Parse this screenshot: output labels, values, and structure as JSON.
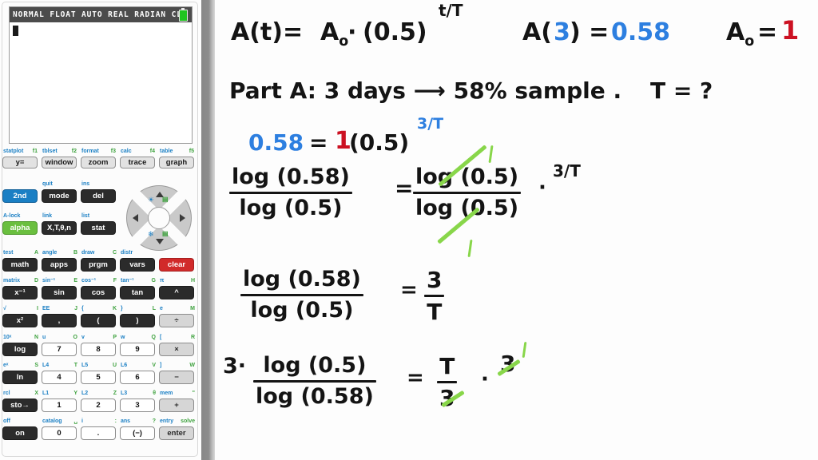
{
  "calculator": {
    "screen": {
      "status_text": "NORMAL FLOAT AUTO REAL RADIAN CL",
      "battery_icon": "battery-icon",
      "cursor": "█"
    },
    "fkey_row": [
      {
        "label": "y=",
        "second": "statplot",
        "alpha": "f1"
      },
      {
        "label": "window",
        "second": "tblset",
        "alpha": "f2"
      },
      {
        "label": "zoom",
        "second": "format",
        "alpha": "f3"
      },
      {
        "label": "trace",
        "second": "calc",
        "alpha": "f4"
      },
      {
        "label": "graph",
        "second": "table",
        "alpha": "f5"
      }
    ],
    "rows": [
      [
        {
          "label": "2nd",
          "style": "blue",
          "second": "",
          "alpha": ""
        },
        {
          "label": "mode",
          "style": "dark",
          "second": "quit",
          "alpha": ""
        },
        {
          "label": "del",
          "style": "dark",
          "second": "ins",
          "alpha": ""
        }
      ],
      [
        {
          "label": "alpha",
          "style": "green",
          "second": "A-lock",
          "alpha": ""
        },
        {
          "label": "X,T,θ,n",
          "style": "dark",
          "second": "link",
          "alpha": ""
        },
        {
          "label": "stat",
          "style": "dark",
          "second": "list",
          "alpha": ""
        }
      ],
      [
        {
          "label": "math",
          "style": "dark",
          "second": "test",
          "alpha": "A"
        },
        {
          "label": "apps",
          "style": "dark",
          "second": "angle",
          "alpha": "B"
        },
        {
          "label": "prgm",
          "style": "dark",
          "second": "draw",
          "alpha": "C"
        },
        {
          "label": "vars",
          "style": "dark",
          "second": "distr",
          "alpha": ""
        },
        {
          "label": "clear",
          "style": "red",
          "second": "",
          "alpha": ""
        }
      ],
      [
        {
          "label": "x⁻¹",
          "style": "dark",
          "second": "matrix",
          "alpha": "D"
        },
        {
          "label": "sin",
          "style": "dark",
          "second": "sin⁻¹",
          "alpha": "E"
        },
        {
          "label": "cos",
          "style": "dark",
          "second": "cos⁻¹",
          "alpha": "F"
        },
        {
          "label": "tan",
          "style": "dark",
          "second": "tan⁻¹",
          "alpha": "G"
        },
        {
          "label": "^",
          "style": "dark",
          "second": "π",
          "alpha": "H"
        }
      ],
      [
        {
          "label": "x²",
          "style": "dark",
          "second": "√",
          "alpha": "I"
        },
        {
          "label": ",",
          "style": "dark",
          "second": "EE",
          "alpha": "J"
        },
        {
          "label": "(",
          "style": "dark",
          "second": "{",
          "alpha": "K"
        },
        {
          "label": ")",
          "style": "dark",
          "second": "}",
          "alpha": "L"
        },
        {
          "label": "÷",
          "style": "gray",
          "second": "e",
          "alpha": "M"
        }
      ],
      [
        {
          "label": "log",
          "style": "dark",
          "second": "10ˣ",
          "alpha": "N"
        },
        {
          "label": "7",
          "style": "light",
          "second": "u",
          "alpha": "O"
        },
        {
          "label": "8",
          "style": "light",
          "second": "v",
          "alpha": "P"
        },
        {
          "label": "9",
          "style": "light",
          "second": "w",
          "alpha": "Q"
        },
        {
          "label": "×",
          "style": "gray",
          "second": "[",
          "alpha": "R"
        }
      ],
      [
        {
          "label": "ln",
          "style": "dark",
          "second": "eˣ",
          "alpha": "S"
        },
        {
          "label": "4",
          "style": "light",
          "second": "L4",
          "alpha": "T"
        },
        {
          "label": "5",
          "style": "light",
          "second": "L5",
          "alpha": "U"
        },
        {
          "label": "6",
          "style": "light",
          "second": "L6",
          "alpha": "V"
        },
        {
          "label": "−",
          "style": "gray",
          "second": "]",
          "alpha": "W"
        }
      ],
      [
        {
          "label": "sto→",
          "style": "dark",
          "second": "rcl",
          "alpha": "X"
        },
        {
          "label": "1",
          "style": "light",
          "second": "L1",
          "alpha": "Y"
        },
        {
          "label": "2",
          "style": "light",
          "second": "L2",
          "alpha": "Z"
        },
        {
          "label": "3",
          "style": "light",
          "second": "L3",
          "alpha": "θ"
        },
        {
          "label": "+",
          "style": "gray",
          "second": "mem",
          "alpha": "\""
        }
      ],
      [
        {
          "label": "on",
          "style": "dark",
          "second": "off",
          "alpha": ""
        },
        {
          "label": "0",
          "style": "light",
          "second": "catalog",
          "alpha": "␣"
        },
        {
          "label": ".",
          "style": "light",
          "second": "i",
          "alpha": ":"
        },
        {
          "label": "(−)",
          "style": "light",
          "second": "ans",
          "alpha": "?"
        },
        {
          "label": "enter",
          "style": "gray",
          "second": "entry",
          "alpha": "solve"
        }
      ]
    ],
    "dpad": {
      "up": "▲",
      "down": "▼",
      "left": "◀",
      "right": "▶",
      "brightness_up": "☀",
      "brightness_down": "❄",
      "contrast_up": "▤",
      "contrast_down": "▤"
    }
  },
  "board": {
    "colors": {
      "black": "#141414",
      "blue": "#2d7fe0",
      "red": "#cc1122",
      "green": "#88d64a"
    },
    "line1": {
      "formula_lhs": "A(t)=",
      "base": "A",
      "base_sub": "o",
      "dot": "·",
      "paren": "(0.5)",
      "exponent": "t/T",
      "eval_a": "A(",
      "eval_arg": "3",
      "eval_close": ") =",
      "eval_value": "0.58",
      "a0_label": "A",
      "a0_sub": "o",
      "a0_eq": "=",
      "a0_value": "1"
    },
    "line2": {
      "text": "Part A:  3 days ⟶ 58% sample .",
      "question": "T = ?"
    },
    "line3": {
      "lhs": "0.58",
      "eq": "=",
      "coeff": "1",
      "paren": "(0.5)",
      "exponent": "3/T"
    },
    "line4": {
      "left_num": "log (0.58)",
      "left_den": "log (0.5)",
      "eq": "=",
      "right_num": "log (0.5)",
      "right_den": "log (0.5)",
      "right_mult": "·",
      "right_exp": "3/T",
      "cancel_tick_top": "1",
      "cancel_tick_bottom": "1"
    },
    "line5": {
      "left_num": "log (0.58)",
      "left_den": "log (0.5)",
      "eq": "=",
      "right_num": "3",
      "right_den": "T"
    },
    "line6": {
      "left_coeff": "3·",
      "left_num": "log  (0.5)",
      "left_den": "log (0.58)",
      "eq": "=",
      "right_num": "T",
      "right_den": "3",
      "right_mult": "·",
      "right_factor": "3",
      "cancel_tick": "1"
    }
  }
}
